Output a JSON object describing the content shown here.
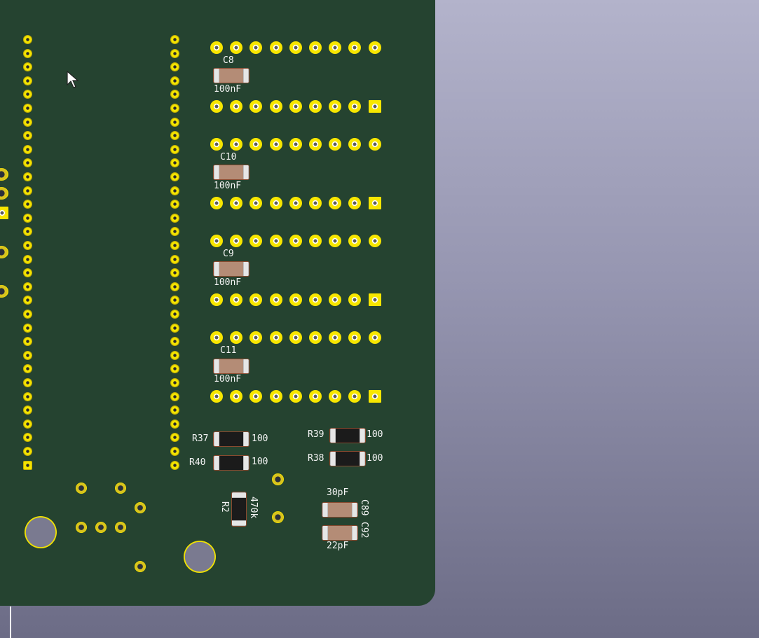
{
  "colors": {
    "board": "#254330",
    "background_top": "#b3b3cb",
    "background_bottom": "#6c6c86",
    "copper": "#f3e300",
    "silkscreen": "#f5f5f5"
  },
  "capacitors": [
    {
      "ref": "C8",
      "value": "100nF"
    },
    {
      "ref": "C10",
      "value": "100nF"
    },
    {
      "ref": "C9",
      "value": "100nF"
    },
    {
      "ref": "C11",
      "value": "100nF"
    }
  ],
  "resistors": {
    "r37": {
      "ref": "R37",
      "value": "100"
    },
    "r40": {
      "ref": "R40",
      "value": "100"
    },
    "r39": {
      "ref": "R39",
      "value": "100"
    },
    "r38": {
      "ref": "R38",
      "value": "100"
    },
    "r2": {
      "ref": "R2",
      "value": "470k"
    }
  },
  "small_caps": {
    "c89": {
      "ref": "C89",
      "value": "30pF"
    },
    "c92": {
      "ref": "C92",
      "value": "22pF"
    }
  },
  "cursor_icon": "arrow-pointer-icon"
}
